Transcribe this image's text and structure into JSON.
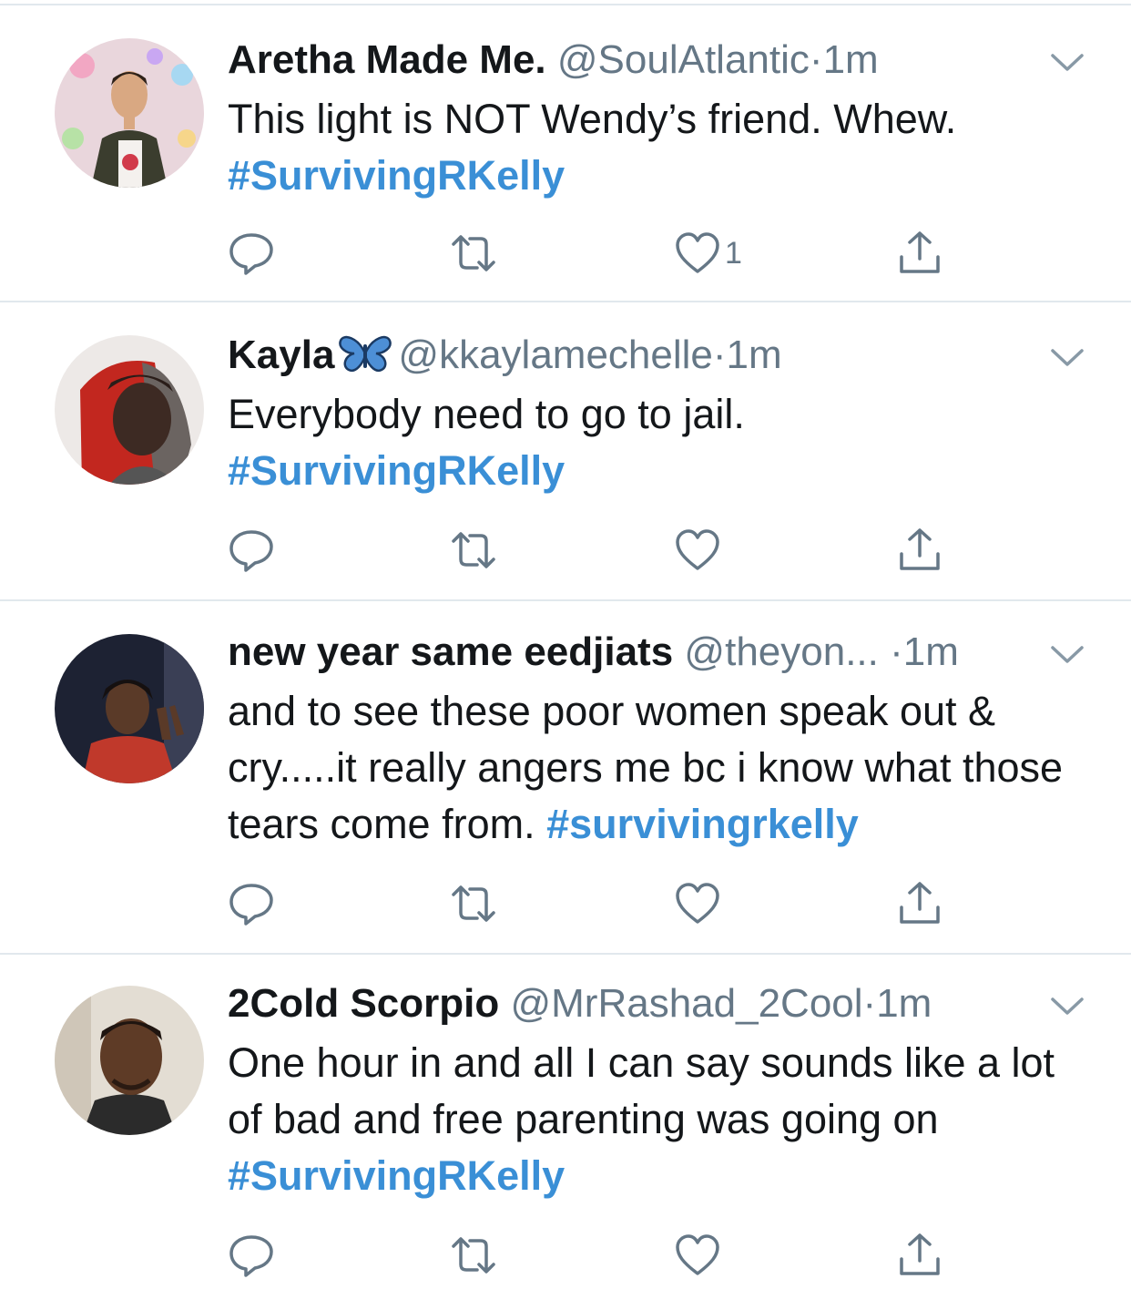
{
  "tweets": [
    {
      "name": "Aretha Made Me.",
      "handle": "@SoulAtlantic",
      "separator": "·",
      "time": "1m",
      "text": "This light is NOT Wendy’s friend. Whew.",
      "hashtag": "#SurvivingRKelly",
      "like_count": "1",
      "has_butterfly": false
    },
    {
      "name": "Kayla",
      "handle": "@kkaylamechelle",
      "separator": "·",
      "time": "1m",
      "text": "Everybody need to go to jail.",
      "hashtag": "#SurvivingRKelly",
      "like_count": "",
      "has_butterfly": true
    },
    {
      "name": "new year same eedjiats",
      "handle": "@theyon...",
      "separator": "·",
      "time": "1m",
      "text": "and to see these poor women speak out & cry.....it really angers me bc i know what those tears come from.",
      "hashtag": "#survivingrkelly",
      "like_count": "",
      "has_butterfly": false
    },
    {
      "name": "2Cold Scorpio",
      "handle": "@MrRashad_2Cool",
      "separator": "·",
      "time": "1m",
      "text": "One hour in and all I can say sounds like a lot of bad and free parenting was going on",
      "hashtag": "#SurvivingRKelly",
      "like_count": "",
      "has_butterfly": false
    }
  ],
  "icons": {
    "reply": "reply-icon",
    "retweet": "retweet-icon",
    "like": "heart-icon",
    "share": "share-icon",
    "caret": "chevron-down-icon"
  },
  "colors": {
    "hashtag": "#3a8fd6",
    "secondary_text": "#657786",
    "primary_text": "#14171a",
    "divider": "#e1e8ed"
  }
}
